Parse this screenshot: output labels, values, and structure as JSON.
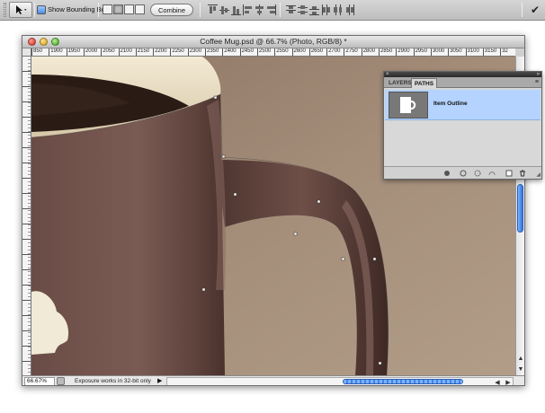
{
  "options_bar": {
    "tool_icon": "path-selection-arrow-icon",
    "show_bounding_box_label": "Show Bounding Box",
    "show_bounding_box_checked": true,
    "combine_label": "Combine",
    "commit_icon": "checkmark-icon"
  },
  "document": {
    "title": "Coffee Mug.psd @ 66.7% (Photo, RGB/8) *",
    "ruler_ticks": [
      "850",
      "1900",
      "1950",
      "2000",
      "2050",
      "2100",
      "2150",
      "2200",
      "2250",
      "2300",
      "2350",
      "2400",
      "2450",
      "2500",
      "2550",
      "2600",
      "2650",
      "2700",
      "2750",
      "2800",
      "2850",
      "2900",
      "2950",
      "3000",
      "3050",
      "3100",
      "3150",
      "32"
    ],
    "zoom": "66.67%",
    "status_text": "Exposure works in 32-bit only"
  },
  "paths_panel": {
    "tabs": [
      "LAYERS",
      "PATHS"
    ],
    "active_tab": "PATHS",
    "paths": [
      {
        "name": "Item Outline",
        "selected": true
      }
    ],
    "footer_icons": [
      "fill-path-icon",
      "stroke-path-icon",
      "load-selection-icon",
      "make-work-path-icon",
      "new-path-icon",
      "delete-path-icon"
    ]
  },
  "colors": {
    "selection": "#b4d3ff",
    "accent": "#3d83e6",
    "mug_body": "#6e504a",
    "background": "#9b8470"
  }
}
